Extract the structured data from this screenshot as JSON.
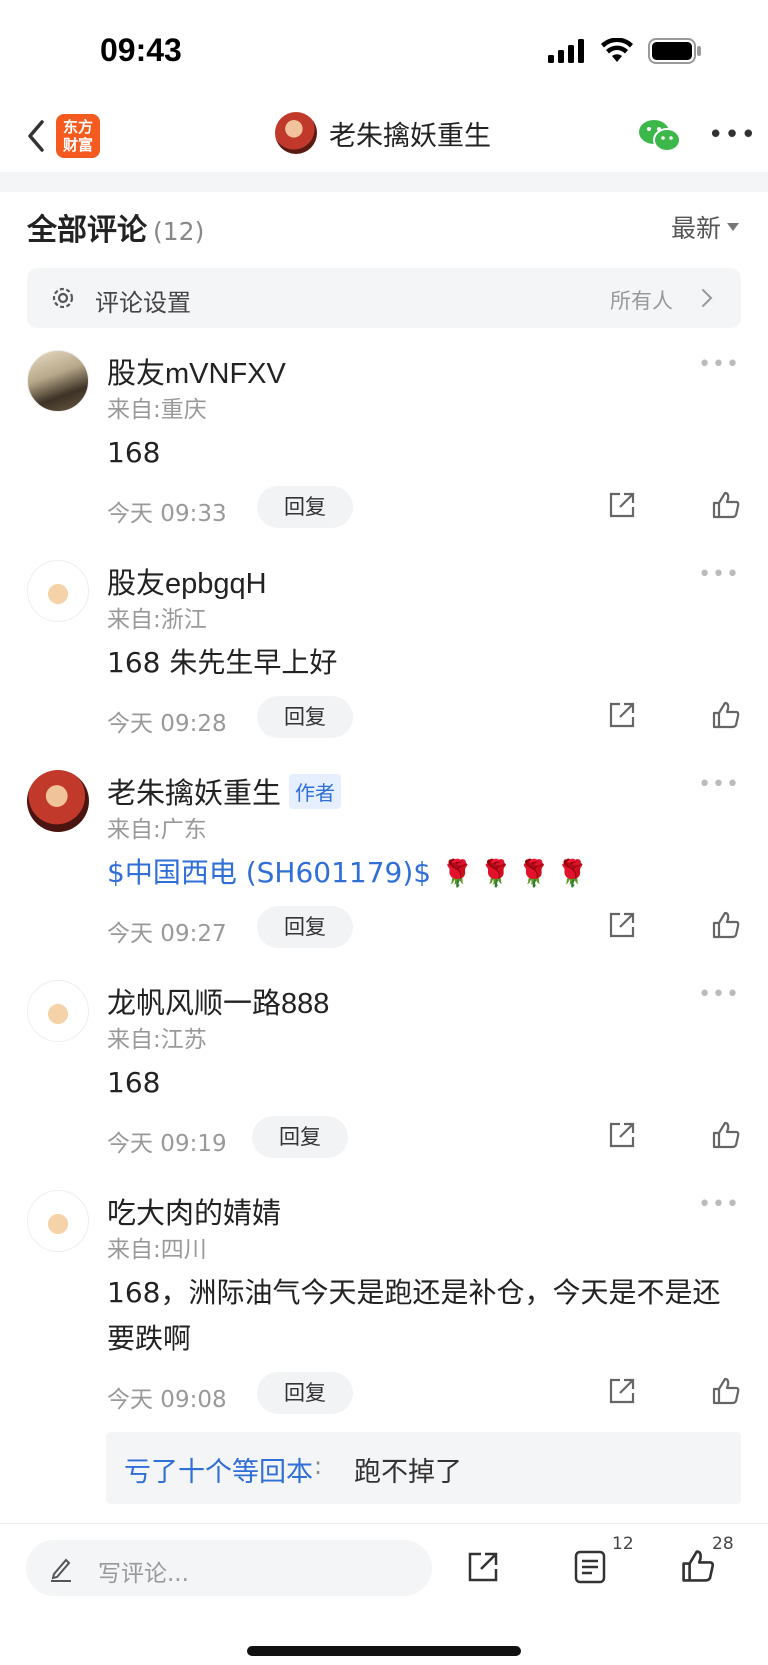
{
  "status_bar": {
    "time": "09:43"
  },
  "nav": {
    "logo_text": "东方财富",
    "title": "老朱擒妖重生"
  },
  "section": {
    "title": "全部评论",
    "count": "(12)",
    "sort_label": "最新"
  },
  "settings": {
    "label": "评论设置",
    "value": "所有人"
  },
  "reply_label": "回复",
  "author_badge": "作者",
  "comments": [
    {
      "name": "股友mVNFXV",
      "location": "来自:重庆",
      "text": "168",
      "time": "今天 09:33"
    },
    {
      "name": "股友epbgqH",
      "location": "来自:浙江",
      "text": "168 朱先生早上好",
      "time": "今天 09:28"
    },
    {
      "name": "老朱擒妖重生",
      "location": "来自:广东",
      "text": "$中国西电 (SH601179)$",
      "roses": "🌹🌹🌹🌹",
      "time": "今天 09:27"
    },
    {
      "name": "龙帆风顺一路888",
      "location": "来自:江苏",
      "text": "168",
      "time": "今天 09:19"
    },
    {
      "name": "吃大肉的婧婧",
      "location": "来自:四川",
      "text": "168，洲际油气今天是跑还是补仓，今天是不是还要跌啊",
      "time": "今天 09:08"
    }
  ],
  "sub_reply": {
    "user": "亏了十个等回本",
    "separator": ":",
    "text": "跑不掉了"
  },
  "bottom_bar": {
    "placeholder": "写评论...",
    "comment_count": "12",
    "like_count": "28"
  }
}
